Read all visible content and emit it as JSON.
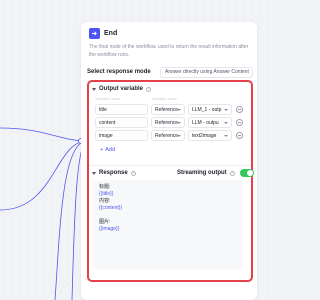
{
  "node": {
    "title": "End",
    "description": "The final node of the workflow, used to return the result information after the workflow runs."
  },
  "response_mode": {
    "label": "Select response mode",
    "value": "Answer directly using Answer Content"
  },
  "output": {
    "title": "Output variable",
    "col_name": "Variable name",
    "col_value": "Variable value",
    "rows": [
      {
        "name": "title",
        "type": "Reference",
        "value": "LLM_1 - outp"
      },
      {
        "name": "content",
        "type": "Reference",
        "value": "LLM - outpu"
      },
      {
        "name": "image",
        "type": "Reference",
        "value": "text2image"
      }
    ],
    "add_label": "Add"
  },
  "response": {
    "title": "Response",
    "streaming_label": "Streaming output",
    "streaming_on": true,
    "lines": [
      {
        "label": "标题:",
        "var": "{{title}}"
      },
      {
        "label": "内容:",
        "var": "{{content}}"
      },
      {
        "label": "图片:",
        "var": "{{image}}"
      }
    ]
  },
  "colors": {
    "accent": "#4e54f0",
    "highlight": "#e5414b",
    "toggle": "#34c759"
  }
}
